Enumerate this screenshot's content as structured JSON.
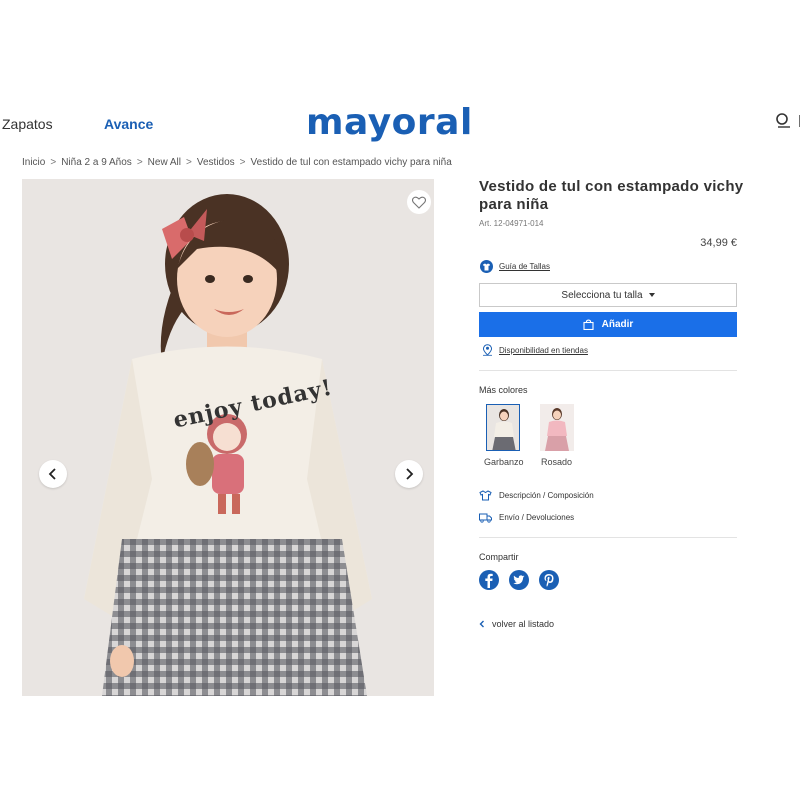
{
  "header": {
    "nav": [
      "Zapatos",
      "Avance"
    ],
    "logo": "mayoral",
    "accent_color": "#1a5fb4",
    "search_icon": "search-icon"
  },
  "breadcrumb": [
    "Inicio",
    "Niña 2 a 9 Años",
    "New All",
    "Vestidos",
    "Vestido de tul con estampado vichy para niña"
  ],
  "gallery": {
    "shirt_print": "enjoy today!",
    "favorite_icon": "heart-icon",
    "prev_icon": "chevron-left-icon",
    "next_icon": "chevron-right-icon"
  },
  "product": {
    "title": "Vestido de tul con estampado vichy para niña",
    "article": "Art. 12-04971-014",
    "price": "34,99 €",
    "size_guide": "Guía de Tallas",
    "size_select": "Selecciona tu talla",
    "add_button": "Añadir",
    "add_button_color": "#1a6fe8",
    "availability": "Disponibilidad en tiendas"
  },
  "more_colors": {
    "label": "Más colores",
    "swatches": [
      {
        "label": "Garbanzo",
        "selected": true
      },
      {
        "label": "Rosado",
        "selected": false
      }
    ]
  },
  "info_links": {
    "description": "Descripción / Composición",
    "shipping": "Envío / Devoluciones"
  },
  "share": {
    "label": "Compartir",
    "icons": [
      "facebook-icon",
      "twitter-icon",
      "pinterest-icon"
    ]
  },
  "back_link": "volver al listado"
}
